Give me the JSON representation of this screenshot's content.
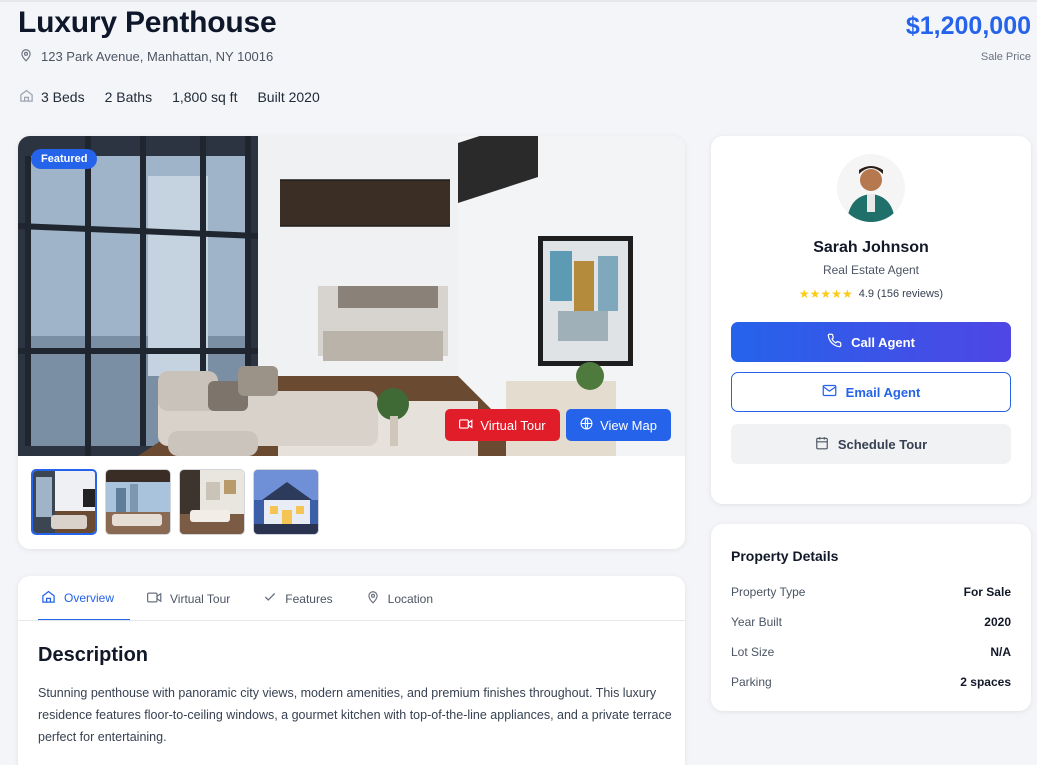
{
  "listing": {
    "title": "Luxury Penthouse",
    "address": "123 Park Avenue, Manhattan, NY 10016",
    "price": "$1,200,000",
    "price_label": "Sale Price",
    "specs": {
      "beds": "3 Beds",
      "baths": "2 Baths",
      "area": "1,800 sq ft",
      "built": "Built 2020"
    }
  },
  "gallery": {
    "badge": "Featured",
    "virtual_tour_label": "Virtual Tour",
    "view_map_label": "View Map",
    "thumbnails": [
      "living-room",
      "balcony-lounge",
      "open-plan-interior",
      "house-exterior-night"
    ],
    "active_thumbnail": 0
  },
  "tabs": [
    {
      "label": "Overview",
      "icon": "home-icon",
      "active": true
    },
    {
      "label": "Virtual Tour",
      "icon": "video-icon",
      "active": false
    },
    {
      "label": "Features",
      "icon": "check-icon",
      "active": false
    },
    {
      "label": "Location",
      "icon": "map-pin-icon",
      "active": false
    }
  ],
  "description": {
    "title": "Description",
    "text": "Stunning penthouse with panoramic city views, modern amenities, and premium finishes throughout. This luxury residence features floor-to-ceiling windows, a gourmet kitchen with top-of-the-line appliances, and a private terrace perfect for entertaining."
  },
  "agent": {
    "name": "Sarah Johnson",
    "role": "Real Estate Agent",
    "stars": "★★★★★",
    "rating_text": "4.9 (156 reviews)",
    "call_label": "Call Agent",
    "email_label": "Email Agent",
    "schedule_label": "Schedule Tour"
  },
  "details": {
    "title": "Property Details",
    "rows": [
      {
        "label": "Property Type",
        "value": "For Sale"
      },
      {
        "label": "Year Built",
        "value": "2020"
      },
      {
        "label": "Lot Size",
        "value": "N/A"
      },
      {
        "label": "Parking",
        "value": "2 spaces"
      }
    ]
  },
  "colors": {
    "accent": "#2563eb",
    "tour_red": "#e11d2a",
    "star": "#facc15"
  }
}
